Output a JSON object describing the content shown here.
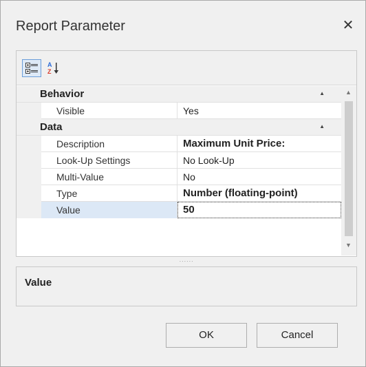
{
  "dialog": {
    "title": "Report Parameter",
    "close_glyph": "✕"
  },
  "toolbar": {
    "categorized_icon": "categorized-icon",
    "alphabetical_icon": "sort-az-icon"
  },
  "grid": {
    "categories": [
      {
        "label": "Behavior",
        "rows": [
          {
            "name": "Visible",
            "value": "Yes",
            "bold": false
          }
        ]
      },
      {
        "label": "Data",
        "rows": [
          {
            "name": "Description",
            "value": "Maximum Unit Price:",
            "bold": true
          },
          {
            "name": "Look-Up Settings",
            "value": "No Look-Up",
            "bold": false
          },
          {
            "name": "Multi-Value",
            "value": "No",
            "bold": false
          },
          {
            "name": "Type",
            "value": "Number (floating-point)",
            "bold": true
          },
          {
            "name": "Value",
            "value": "50",
            "bold": true,
            "selected": true
          }
        ]
      }
    ]
  },
  "description_panel": {
    "title": "Value"
  },
  "buttons": {
    "ok": "OK",
    "cancel": "Cancel"
  }
}
